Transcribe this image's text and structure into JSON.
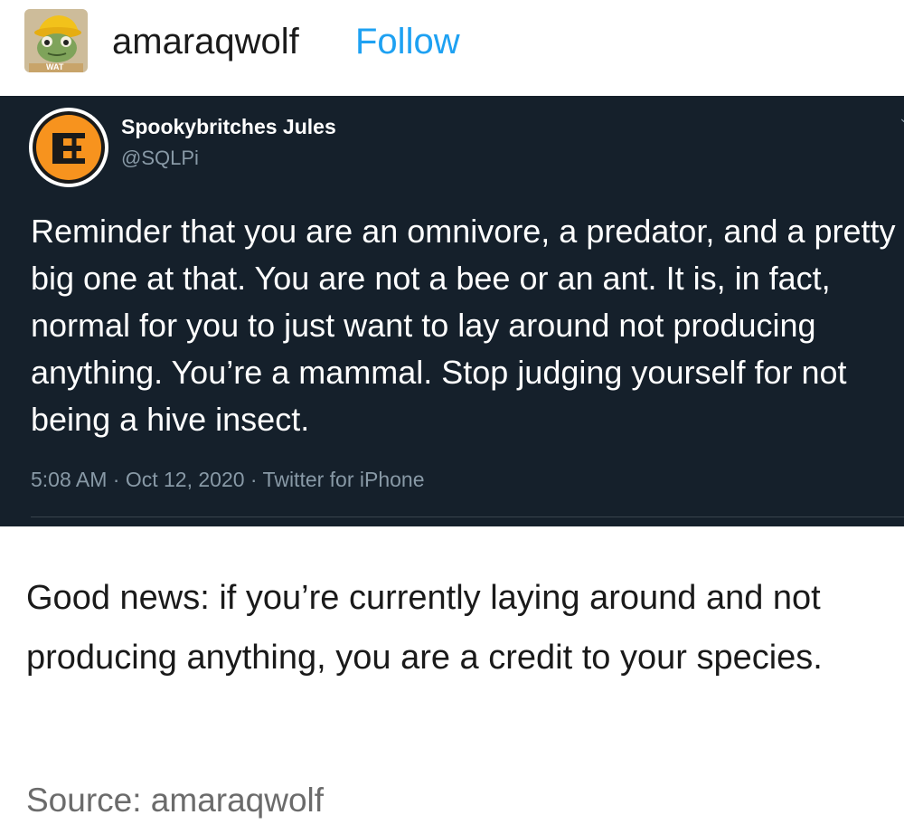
{
  "post": {
    "author": "amaraqwolf",
    "follow_label": "Follow",
    "avatar_badge": "WAT",
    "avatar_icon": "frog-in-hat-avatar-icon"
  },
  "tweet": {
    "display_name": "Spookybritches Jules",
    "handle": "@SQLPi",
    "avatar_icon": "orange-circle-logo-icon",
    "text": "Reminder that you are an omnivore, a predator, and a pretty big one at that. You are not a bee or an ant. It is, in fact, normal for you to just want to lay around not producing anything. You’re a mammal. Stop judging yourself for not being a hive insect.",
    "meta": "5:08 AM · Oct 12, 2020 · Twitter for iPhone",
    "colors": {
      "background": "#15202b",
      "secondary_text": "#8899a6",
      "avatar_orange": "#f7931e"
    }
  },
  "reply": {
    "text": "Good news: if you’re currently laying around and not producing anything, you are a credit to your species."
  },
  "footer": {
    "source_text": "Source: amaraqwolf"
  },
  "colors": {
    "follow_link": "#1ea1f2"
  }
}
